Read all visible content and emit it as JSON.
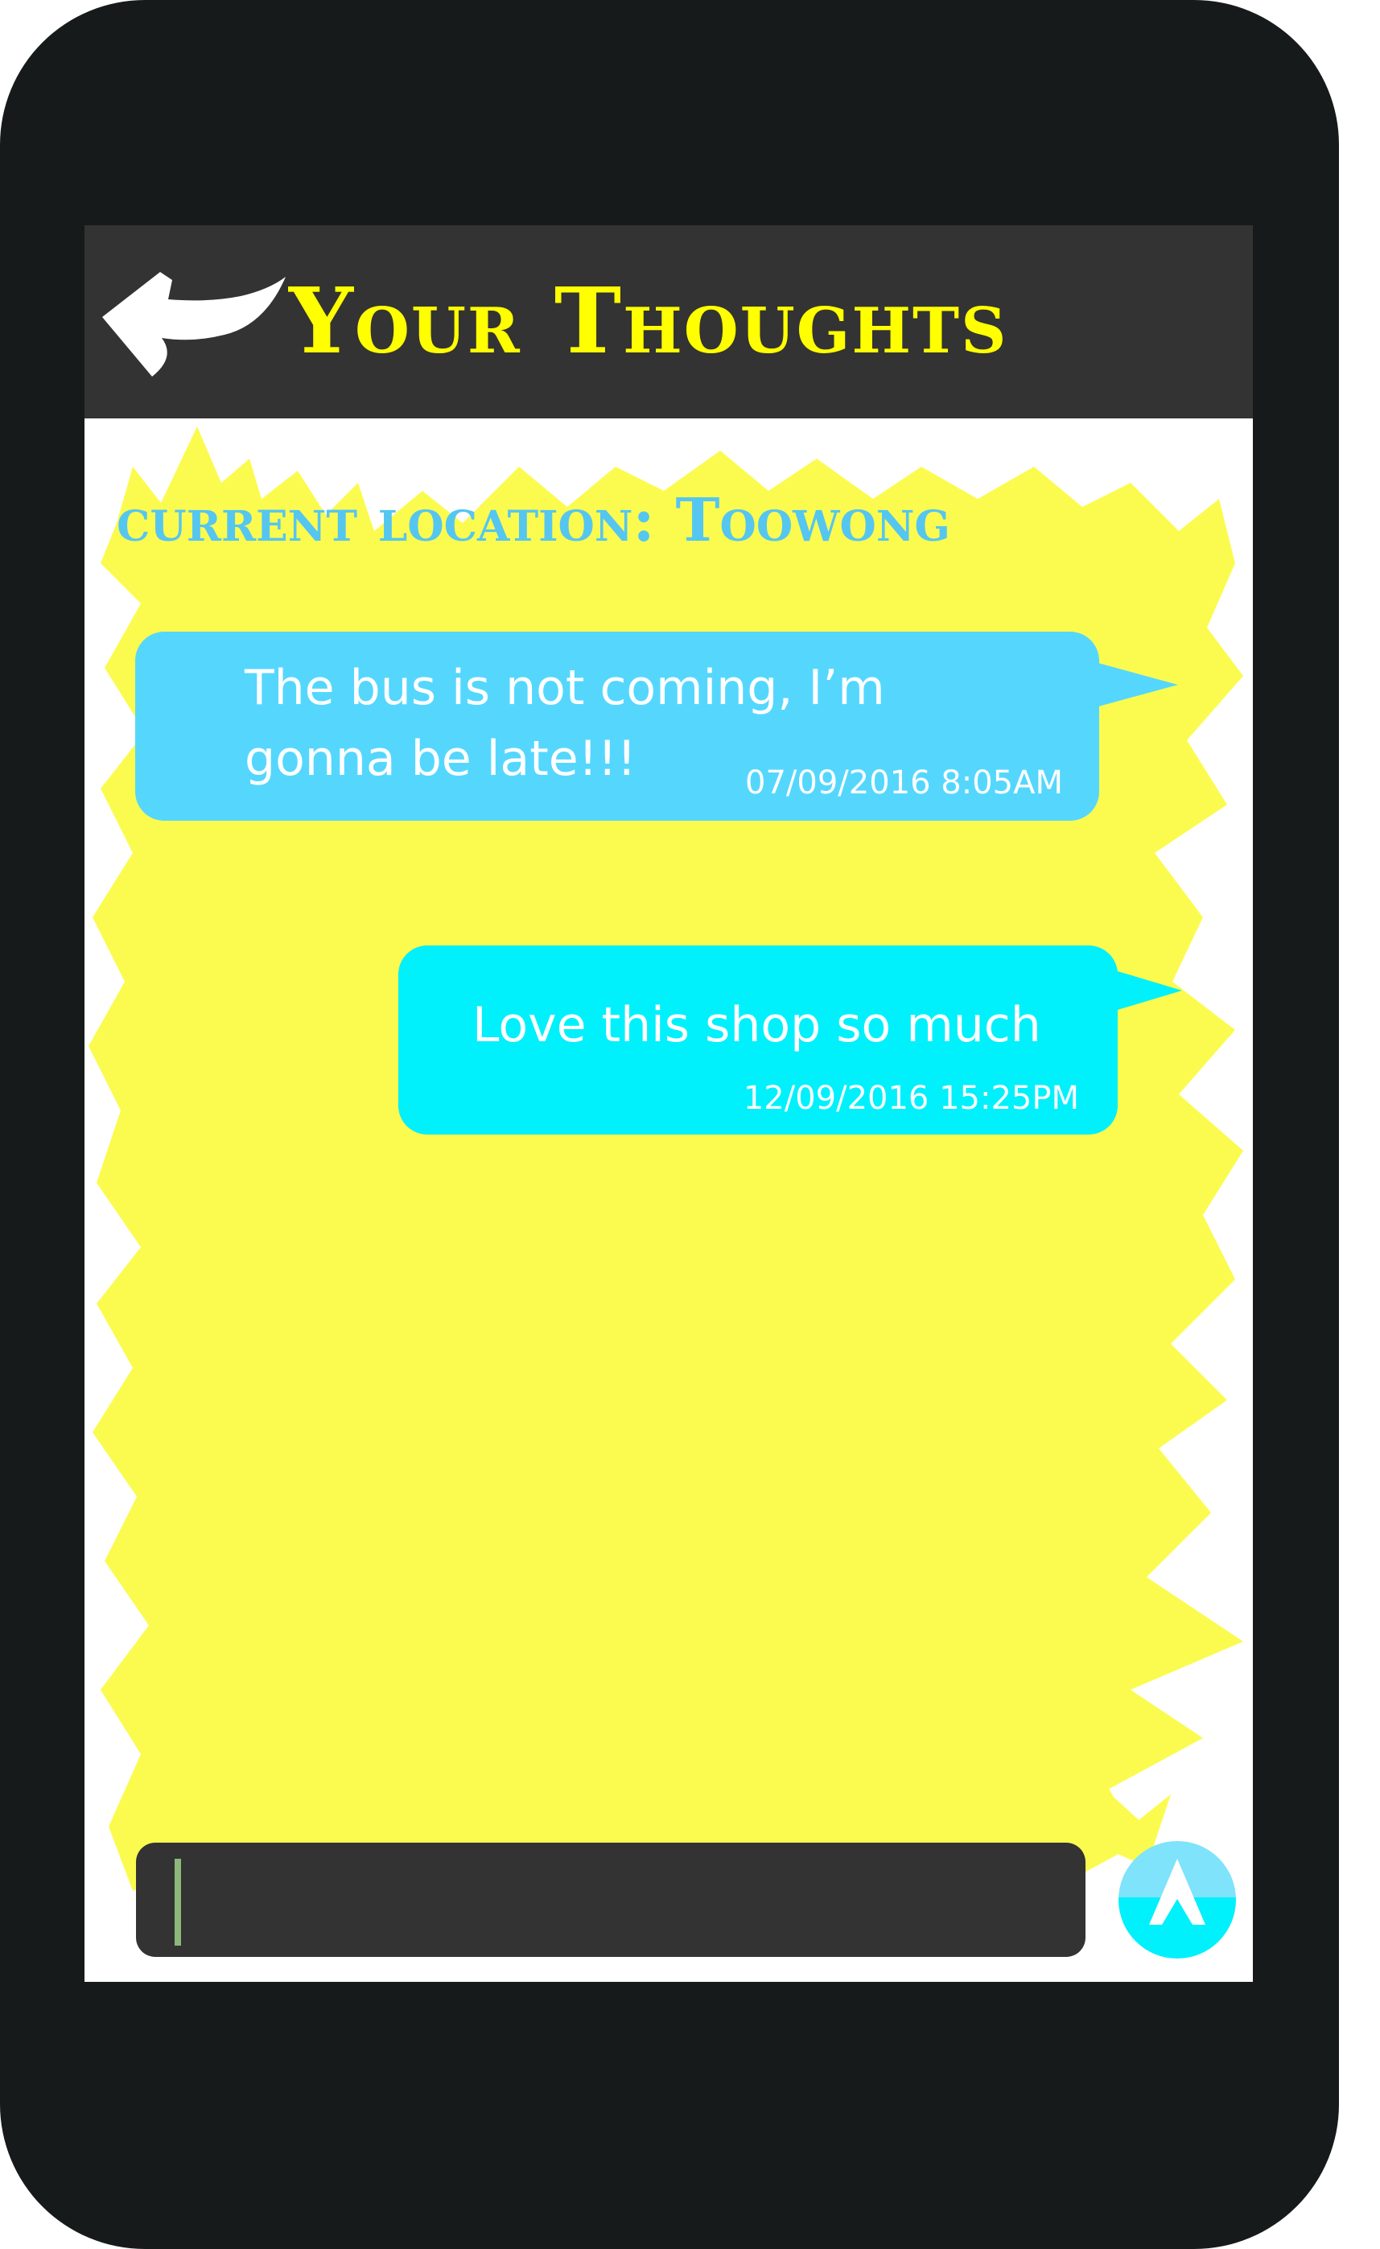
{
  "header": {
    "title": "Your Thoughts"
  },
  "location": {
    "text": "current location: Toowong"
  },
  "messages": [
    {
      "text": "The bus is not coming, I’m gonna be late!!!",
      "timestamp": "07/09/2016 8:05AM"
    },
    {
      "text": "Love this shop so much",
      "timestamp": "12/09/2016 15:25PM"
    }
  ],
  "composer": {
    "value": "",
    "placeholder": ""
  },
  "icons": {
    "back": "back-arrow-icon",
    "send": "send-arrow-icon"
  },
  "colors": {
    "header_bg": "#333333",
    "title": "#ffff00",
    "location": "#55c6f0",
    "bubble_1": "#55d7fd",
    "bubble_2": "#00f0fc",
    "splash": "#fbfb4f",
    "phone_body": "#161a1a"
  }
}
